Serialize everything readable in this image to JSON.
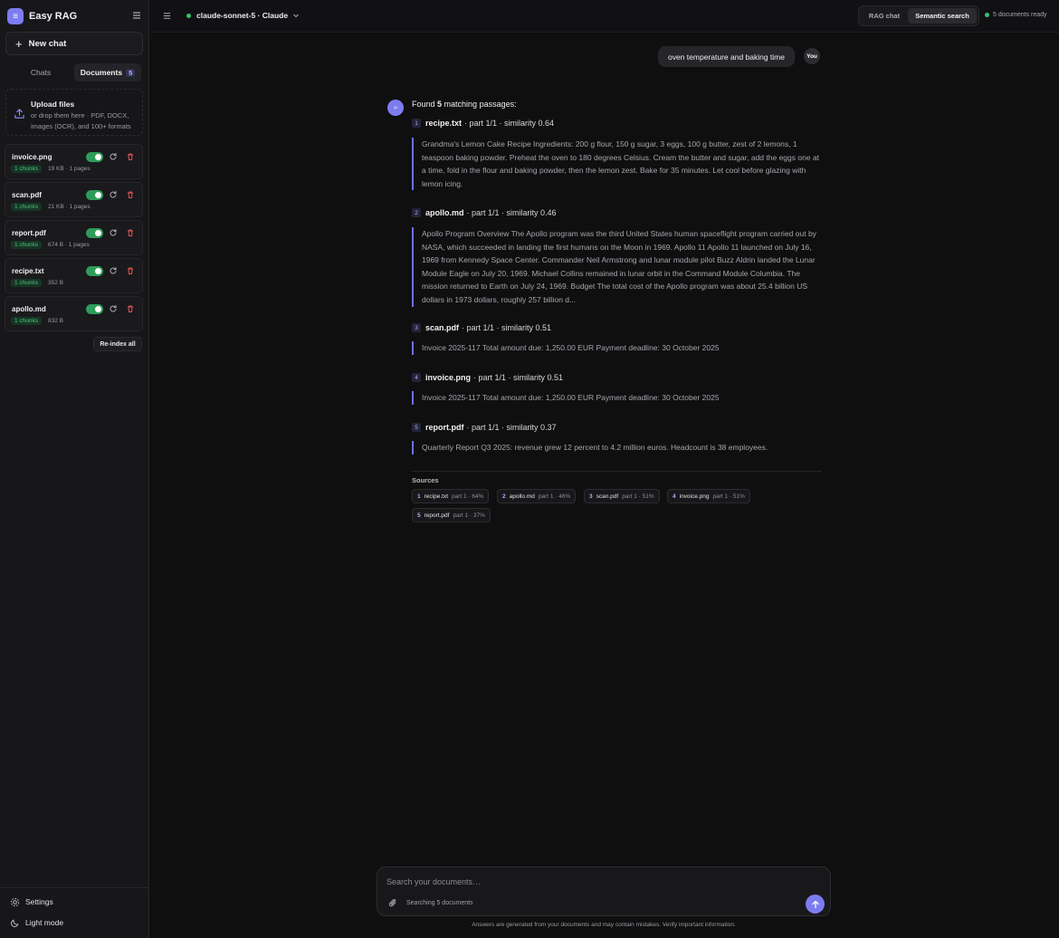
{
  "app": {
    "name": "Easy RAG",
    "logo_glyph": "≡"
  },
  "sidebar": {
    "new_chat_label": "New chat",
    "tabs": [
      {
        "label": "Chats"
      },
      {
        "label": "Documents",
        "count": "5"
      }
    ],
    "upload": {
      "title": "Upload files",
      "subtitle": "or drop them here · PDF, DOCX, images (OCR), and 100+ formats"
    },
    "documents": [
      {
        "name": "invoice.png",
        "chunks": "1 chunks",
        "meta": "19 KB · 1 pages",
        "enabled": true
      },
      {
        "name": "scan.pdf",
        "chunks": "1 chunks",
        "meta": "21 KB · 1 pages",
        "enabled": true
      },
      {
        "name": "report.pdf",
        "chunks": "1 chunks",
        "meta": "674 B · 1 pages",
        "enabled": true
      },
      {
        "name": "recipe.txt",
        "chunks": "1 chunks",
        "meta": "352 B",
        "enabled": true
      },
      {
        "name": "apollo.md",
        "chunks": "1 chunks",
        "meta": "832 B",
        "enabled": true
      }
    ],
    "reindex_label": "Re-index all",
    "settings_label": "Settings",
    "theme_label": "Light mode"
  },
  "header": {
    "model": "claude-sonnet-5 · Claude",
    "modes": [
      {
        "label": "RAG chat"
      },
      {
        "label": "Semantic search"
      }
    ],
    "active_mode": "Semantic search",
    "status": "5 documents ready"
  },
  "chat": {
    "user_query": "oven temperature and baking time",
    "user_avatar": "You",
    "found_prefix": "Found ",
    "found_count": "5",
    "found_suffix": " matching passages:",
    "passages": [
      {
        "num": "1",
        "file": "recipe.txt",
        "meta": "· part 1/1 · similarity 0.64",
        "text": "Grandma's Lemon Cake Recipe Ingredients: 200 g flour, 150 g sugar, 3 eggs, 100 g butter, zest of 2 lemons, 1 teaspoon baking powder. Preheat the oven to 180 degrees Celsius. Cream the butter and sugar, add the eggs one at a time, fold in the flour and baking powder, then the lemon zest. Bake for 35 minutes. Let cool before glazing with lemon icing."
      },
      {
        "num": "2",
        "file": "apollo.md",
        "meta": "· part 1/1 · similarity 0.46",
        "text": "Apollo Program Overview The Apollo program was the third United States human spaceflight program carried out by NASA, which succeeded in landing the first humans on the Moon in 1969. Apollo 11 Apollo 11 launched on July 16, 1969 from Kennedy Space Center. Commander Neil Armstrong and lunar module pilot Buzz Aldrin landed the Lunar Module Eagle on July 20, 1969. Michael Collins remained in lunar orbit in the Command Module Columbia. The mission returned to Earth on July 24, 1969. Budget The total cost of the Apollo program was about 25.4 billion US dollars in 1973 dollars, roughly 257 billion d..."
      },
      {
        "num": "3",
        "file": "scan.pdf",
        "meta": "· part 1/1 · similarity 0.51",
        "text": "Invoice 2025-117 Total amount due: 1,250.00 EUR Payment deadline: 30 October 2025"
      },
      {
        "num": "4",
        "file": "invoice.png",
        "meta": "· part 1/1 · similarity 0.51",
        "text": "Invoice 2025-117 Total amount due: 1,250.00 EUR Payment deadline: 30 October 2025"
      },
      {
        "num": "5",
        "file": "report.pdf",
        "meta": "· part 1/1 · similarity 0.37",
        "text": "Quarterly Report Q3 2025: revenue grew 12 percent to 4.2 million euros. Headcount is 38 employees."
      }
    ],
    "sources_label": "Sources",
    "sources": [
      {
        "num": "1",
        "file": "recipe.txt",
        "meta": "part 1 · 64%"
      },
      {
        "num": "2",
        "file": "apollo.md",
        "meta": "part 1 · 46%"
      },
      {
        "num": "3",
        "file": "scan.pdf",
        "meta": "part 1 · 51%"
      },
      {
        "num": "4",
        "file": "invoice.png",
        "meta": "part 1 · 51%"
      },
      {
        "num": "5",
        "file": "report.pdf",
        "meta": "part 1 · 37%"
      }
    ]
  },
  "composer": {
    "placeholder": "Search your documents…",
    "status": "Searching 5 documents",
    "disclaimer": "Answers are generated from your documents and may contain mistakes. Verify important information."
  },
  "colors": {
    "accent": "#7c7cf0",
    "ready": "#31c46c",
    "toggle_on": "#2e9c5a",
    "delete": "#e05555"
  }
}
